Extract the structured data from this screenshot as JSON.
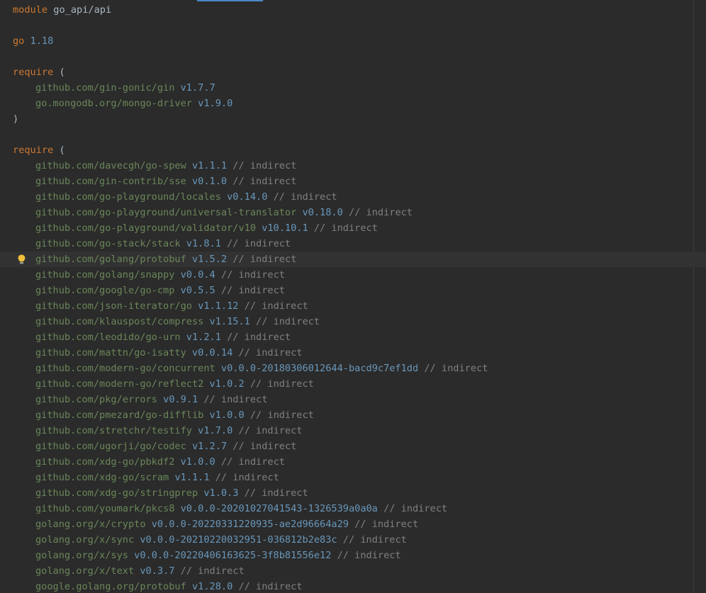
{
  "module_line": {
    "keyword": "module",
    "name": "go_api/api"
  },
  "go_line": {
    "keyword": "go",
    "version": "1.18"
  },
  "require_block_1": {
    "keyword": "require",
    "open": "(",
    "close": ")",
    "deps": [
      {
        "path": "github.com/gin-gonic/gin",
        "version": "v1.7.7"
      },
      {
        "path": "go.mongodb.org/mongo-driver",
        "version": "v1.9.0"
      }
    ]
  },
  "require_block_2": {
    "keyword": "require",
    "open": "(",
    "comment": "// indirect",
    "deps": [
      {
        "path": "github.com/davecgh/go-spew",
        "version": "v1.1.1"
      },
      {
        "path": "github.com/gin-contrib/sse",
        "version": "v0.1.0"
      },
      {
        "path": "github.com/go-playground/locales",
        "version": "v0.14.0"
      },
      {
        "path": "github.com/go-playground/universal-translator",
        "version": "v0.18.0"
      },
      {
        "path": "github.com/go-playground/validator/v10",
        "version": "v10.10.1"
      },
      {
        "path": "github.com/go-stack/stack",
        "version": "v1.8.1"
      },
      {
        "path": "github.com/golang/protobuf",
        "version": "v1.5.2"
      },
      {
        "path": "github.com/golang/snappy",
        "version": "v0.0.4"
      },
      {
        "path": "github.com/google/go-cmp",
        "version": "v0.5.5"
      },
      {
        "path": "github.com/json-iterator/go",
        "version": "v1.1.12"
      },
      {
        "path": "github.com/klauspost/compress",
        "version": "v1.15.1"
      },
      {
        "path": "github.com/leodido/go-urn",
        "version": "v1.2.1"
      },
      {
        "path": "github.com/mattn/go-isatty",
        "version": "v0.0.14"
      },
      {
        "path": "github.com/modern-go/concurrent",
        "version": "v0.0.0-20180306012644-bacd9c7ef1dd"
      },
      {
        "path": "github.com/modern-go/reflect2",
        "version": "v1.0.2"
      },
      {
        "path": "github.com/pkg/errors",
        "version": "v0.9.1"
      },
      {
        "path": "github.com/pmezard/go-difflib",
        "version": "v1.0.0"
      },
      {
        "path": "github.com/stretchr/testify",
        "version": "v1.7.0"
      },
      {
        "path": "github.com/ugorji/go/codec",
        "version": "v1.2.7"
      },
      {
        "path": "github.com/xdg-go/pbkdf2",
        "version": "v1.0.0"
      },
      {
        "path": "github.com/xdg-go/scram",
        "version": "v1.1.1"
      },
      {
        "path": "github.com/xdg-go/stringprep",
        "version": "v1.0.3"
      },
      {
        "path": "github.com/youmark/pkcs8",
        "version": "v0.0.0-20201027041543-1326539a0a0a"
      },
      {
        "path": "golang.org/x/crypto",
        "version": "v0.0.0-20220331220935-ae2d96664a29"
      },
      {
        "path": "golang.org/x/sync",
        "version": "v0.0.0-20210220032951-036812b2e83c"
      },
      {
        "path": "golang.org/x/sys",
        "version": "v0.0.0-20220406163625-3f8b81556e12"
      },
      {
        "path": "golang.org/x/text",
        "version": "v0.3.7"
      },
      {
        "path": "google.golang.org/protobuf",
        "version": "v1.28.0"
      }
    ]
  },
  "intention_bulb": {
    "icon": "lightbulb-icon",
    "color": "#f0c03a"
  },
  "colors": {
    "background": "#2b2b2b",
    "keyword": "#cc7832",
    "path": "#6a8759",
    "version": "#6897bb",
    "comment": "#808080",
    "text": "#a9b7c6"
  }
}
